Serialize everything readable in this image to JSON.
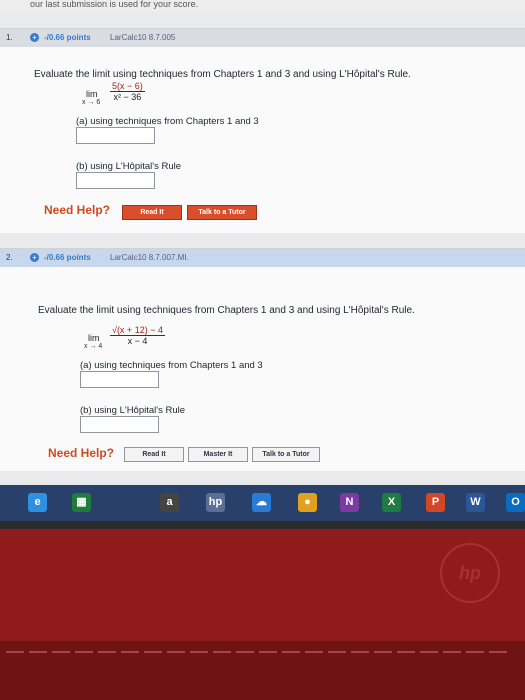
{
  "header": {
    "text": "our last submission is used for your score."
  },
  "questions": [
    {
      "number": "1.",
      "points": "-/0.66 points",
      "source": "LarCalc10 8.7.005",
      "prompt": "Evaluate the limit using techniques from Chapters 1 and 3 and using L'Hôpital's Rule.",
      "lim": "lim",
      "lim_sub": "x → 6",
      "numerator": "5(x − 6)",
      "denominator": "x² − 36",
      "part_a": "(a) using techniques from Chapters 1 and 3",
      "part_b": "(b) using L'Hôpital's Rule",
      "help": "Need Help?",
      "buttons": [
        "Read It",
        "Talk to a Tutor"
      ]
    },
    {
      "number": "2.",
      "points": "-/0.66 points",
      "source": "LarCalc10 8.7.007.MI.",
      "prompt": "Evaluate the limit using techniques from Chapters 1 and 3 and using L'Hôpital's Rule.",
      "lim": "lim",
      "lim_sub": "x → 4",
      "numerator": "√(x + 12) − 4",
      "denominator": "x − 4",
      "part_a": "(a) using techniques from Chapters 1 and 3",
      "part_b": "(b) using L'Hôpital's Rule",
      "help": "Need Help?",
      "buttons": [
        "Read It",
        "Master It",
        "Talk to a Tutor"
      ]
    }
  ],
  "taskbar": {
    "icons": [
      {
        "name": "edge-icon",
        "glyph": "e",
        "color": "#2f8fe0"
      },
      {
        "name": "store-icon",
        "glyph": "▦",
        "color": "#1e7d3a"
      },
      {
        "name": "amazon-icon",
        "glyph": "a",
        "color": "#444444"
      },
      {
        "name": "hp-icon",
        "glyph": "hp",
        "color": "#5a6e96"
      },
      {
        "name": "photos-icon",
        "glyph": "☁",
        "color": "#2a7bd6"
      },
      {
        "name": "chrome-icon",
        "glyph": "●",
        "color": "#e0a020"
      },
      {
        "name": "onenote-icon",
        "glyph": "N",
        "color": "#7a3aa0"
      },
      {
        "name": "excel-icon",
        "glyph": "X",
        "color": "#1f7a43"
      },
      {
        "name": "powerpoint-icon",
        "glyph": "P",
        "color": "#d24726"
      },
      {
        "name": "word-icon",
        "glyph": "W",
        "color": "#2b579a"
      },
      {
        "name": "outlook-icon",
        "glyph": "O",
        "color": "#0a6cc0"
      }
    ]
  },
  "laptop": {
    "logo": "hp"
  }
}
